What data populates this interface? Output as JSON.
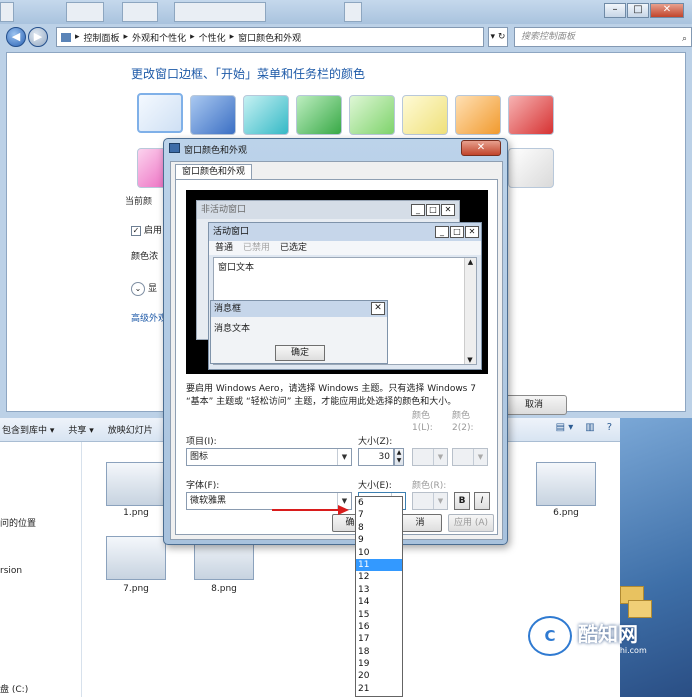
{
  "control_panel": {
    "breadcrumb": [
      "控制面板",
      "外观和个性化",
      "个性化",
      "窗口颜色和外观"
    ],
    "search_placeholder": "搜索控制面板",
    "title": "更改窗口边框、「开始」菜单和任务栏的颜色",
    "current_color_label": "当前颜",
    "aero_checkbox_label": "启用",
    "intensity_label": "颜色浓",
    "show_mixer_label": "显",
    "advanced_link": "高级外观",
    "cancel_button": "取消",
    "swatch_colors": [
      "#e1ecf8",
      "#5b8fd8",
      "#62cfd8",
      "#5fc86b",
      "#9ae08e",
      "#f2e77d",
      "#f4a64a",
      "#de4d4d",
      "#f07ac6",
      "#e2e2e2"
    ]
  },
  "explorer": {
    "toolbar": [
      "包含到库中 ▾",
      "共享 ▾",
      "放映幻灯片"
    ],
    "nav_items": [
      "问的位置",
      "rsion",
      "盘 (C:)"
    ],
    "thumbnails": [
      "1.png",
      "6.png",
      "7.png",
      "8.png"
    ]
  },
  "dialog": {
    "title": "窗口颜色和外观",
    "close": "✕",
    "tab": "窗口颜色和外观",
    "preview": {
      "inactive_title": "非活动窗口",
      "active_title": "活动窗口",
      "menu_normal": "普通",
      "menu_disabled": "已禁用",
      "menu_selected": "已选定",
      "window_text": "窗口文本",
      "msgbox_title": "消息框",
      "msgbox_text": "消息文本",
      "msgbox_ok": "确定"
    },
    "note": "要启用 Windows Aero，请选择 Windows 主题。只有选择 Windows 7 “基本” 主题或 “轻松访问” 主题，才能应用此处选择的颜色和大小。",
    "item_label": "项目(I):",
    "item_value": "图标",
    "size_label": "大小(Z):",
    "size_value": "30",
    "color1_label": "颜色 1(L):",
    "color2_label": "颜色 2(2):",
    "font_label": "字体(F):",
    "font_value": "微软雅黑",
    "font_size_label": "大小(E):",
    "font_size_value": "9",
    "font_color_label": "颜色(R):",
    "bold": "B",
    "italic": "I",
    "ok_button": "确",
    "cancel_button": "消",
    "apply_button": "应用 (A)"
  },
  "size_options": [
    "6",
    "7",
    "8",
    "9",
    "10",
    "11",
    "12",
    "13",
    "14",
    "15",
    "16",
    "17",
    "18",
    "19",
    "20",
    "21"
  ],
  "size_selected": "11",
  "watermark": {
    "brand": "酷知网",
    "url": "www.coozhi.com",
    "logo_text": "C"
  }
}
